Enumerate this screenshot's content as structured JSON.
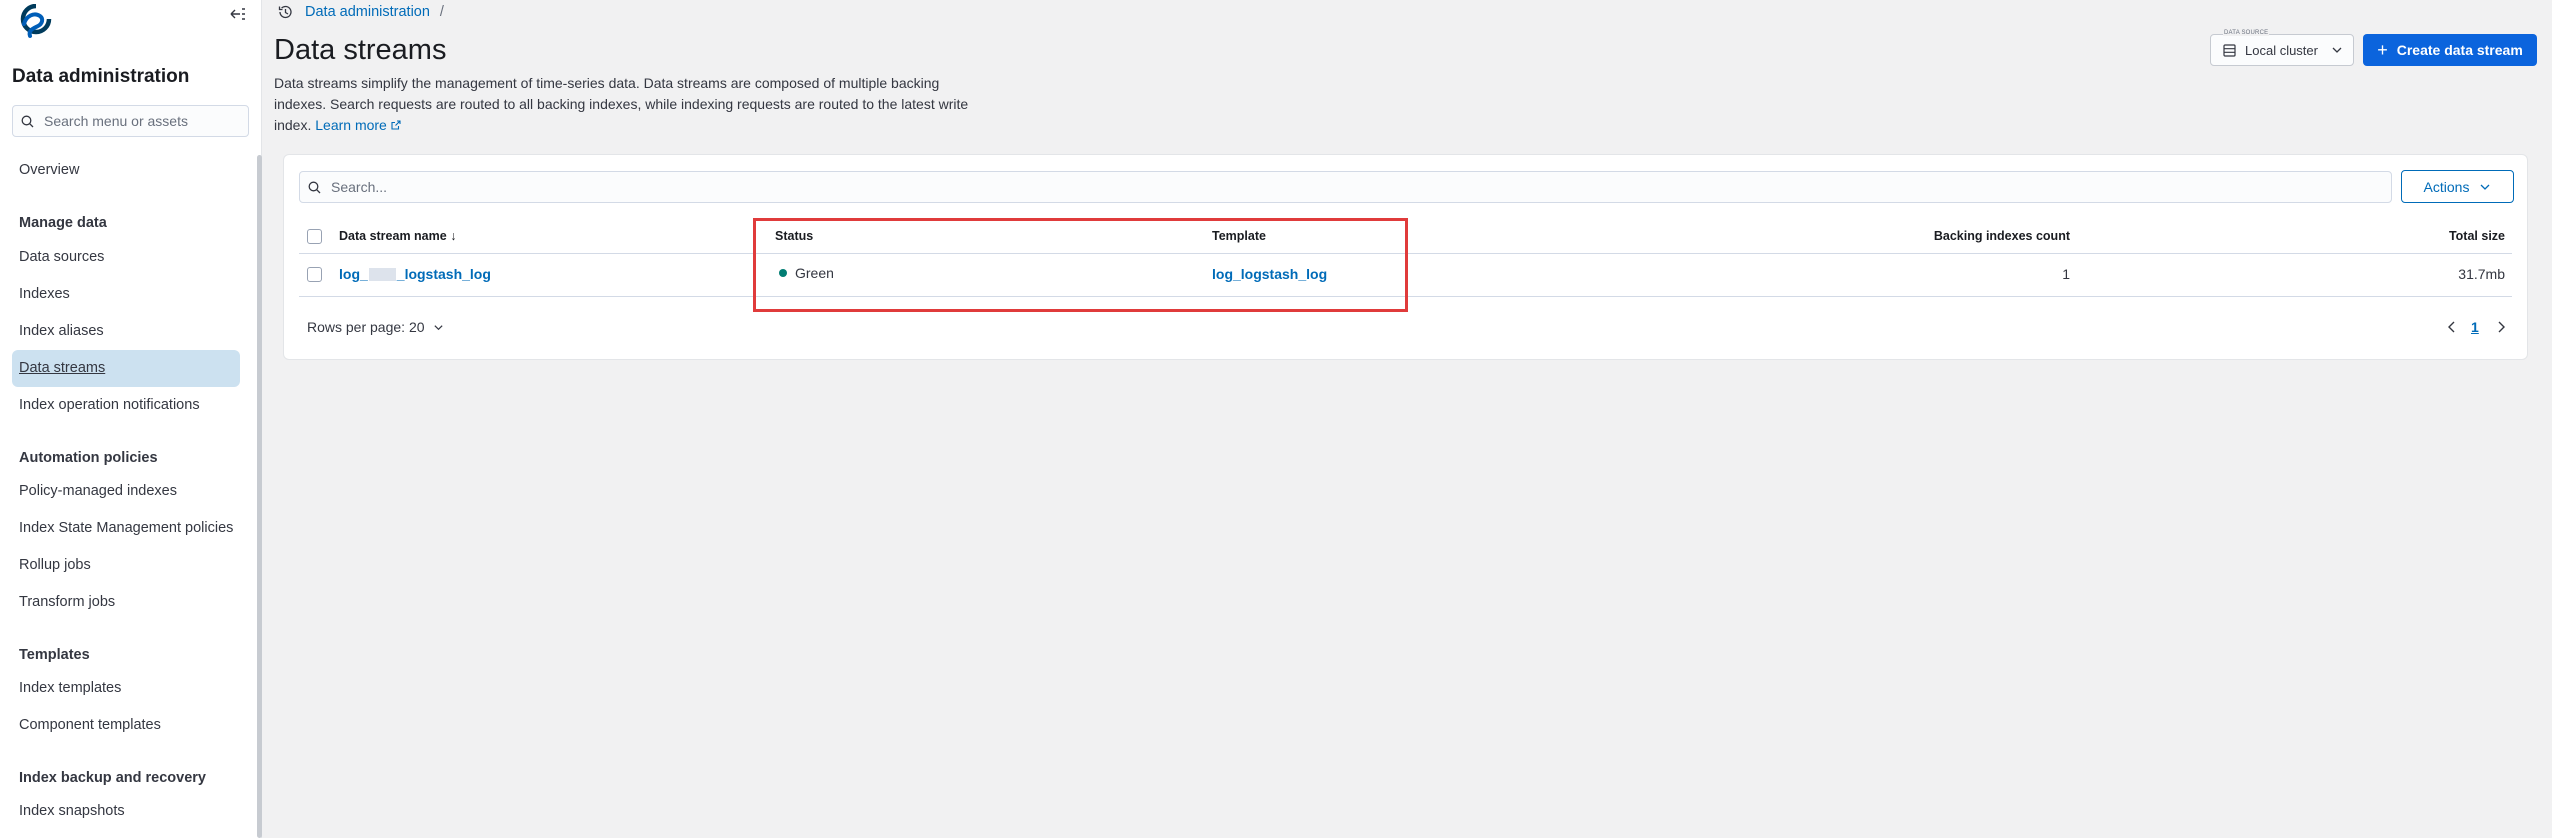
{
  "breadcrumb": {
    "items": [
      "Data administration"
    ],
    "separator": "/"
  },
  "sidebar": {
    "title": "Data administration",
    "search_placeholder": "Search menu or assets",
    "overview": "Overview",
    "groups": [
      {
        "label": "Manage data",
        "items": [
          "Data sources",
          "Indexes",
          "Index aliases",
          "Data streams",
          "Index operation notifications"
        ]
      },
      {
        "label": "Automation policies",
        "items": [
          "Policy-managed indexes",
          "Index State Management policies",
          "Rollup jobs",
          "Transform jobs"
        ]
      },
      {
        "label": "Templates",
        "items": [
          "Index templates",
          "Component templates"
        ]
      },
      {
        "label": "Index backup and recovery",
        "items": [
          "Index snapshots"
        ]
      }
    ],
    "active_item": "Data streams"
  },
  "page": {
    "title": "Data streams",
    "description": "Data streams simplify the management of time-series data. Data streams are composed of multiple backing indexes. Search requests are routed to all backing indexes, while indexing requests are routed to the latest write index.",
    "learn_more": "Learn more"
  },
  "data_source": {
    "legend": "DATA SOURCE",
    "value": "Local cluster"
  },
  "create_button": {
    "label": "Create data stream",
    "icon": "plus-icon"
  },
  "table": {
    "search_placeholder": "Search...",
    "actions_label": "Actions",
    "columns": [
      "Data stream name",
      "Status",
      "Template",
      "Backing indexes count",
      "Total size"
    ],
    "sort_indicator": "↓",
    "rows": [
      {
        "name_prefix": "log_",
        "name_suffix": "_logstash_log",
        "status": "Green",
        "template": "log_logstash_log",
        "backing_indexes": "1",
        "total_size": "31.7mb"
      }
    ],
    "rows_per_page": "Rows per page: 20",
    "current_page": "1"
  },
  "colors": {
    "accent": "#0b64dd",
    "link": "#006bb8",
    "status_green": "#017d73",
    "highlight": "#e03b3b",
    "active_bg": "#cce1f0"
  }
}
